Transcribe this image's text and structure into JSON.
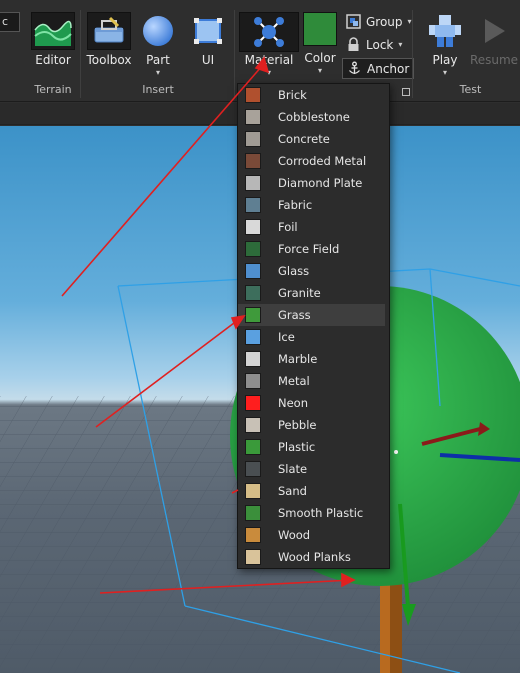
{
  "ribbon": {
    "left_dropdown_char": "c",
    "terrain": {
      "editor_label": "Editor",
      "group_label": "Terrain"
    },
    "insert": {
      "toolbox_label": "Toolbox",
      "part_label": "Part",
      "ui_label": "UI",
      "group_label": "Insert"
    },
    "material_label": "Material",
    "color_label": "Color",
    "color_value": "#2f8b3a",
    "group_label_btn": "Group",
    "lock_label": "Lock",
    "anchor_label": "Anchor",
    "test": {
      "play_label": "Play",
      "resume_label": "Resume",
      "group_label": "Test"
    }
  },
  "material_menu": {
    "selected_index": 10,
    "items": [
      {
        "label": "Brick",
        "swatch": "#b0502e",
        "icon": "brick-icon"
      },
      {
        "label": "Cobblestone",
        "swatch": "#a8a29a",
        "icon": "cobblestone-icon"
      },
      {
        "label": "Concrete",
        "swatch": "#a09b94",
        "icon": "concrete-icon"
      },
      {
        "label": "Corroded Metal",
        "swatch": "#7a4a38",
        "icon": "corroded-metal-icon"
      },
      {
        "label": "Diamond Plate",
        "swatch": "#b7b7b7",
        "icon": "diamond-plate-icon"
      },
      {
        "label": "Fabric",
        "swatch": "#5f7f92",
        "icon": "fabric-icon"
      },
      {
        "label": "Foil",
        "swatch": "#d9d9d9",
        "icon": "foil-icon"
      },
      {
        "label": "Force Field",
        "swatch": "#2d6b3a",
        "icon": "force-field-icon"
      },
      {
        "label": "Glass",
        "swatch": "#4f8fcf",
        "icon": "glass-icon"
      },
      {
        "label": "Granite",
        "swatch": "#3d6e5c",
        "icon": "granite-icon"
      },
      {
        "label": "Grass",
        "swatch": "#3f9a3b",
        "icon": "grass-icon"
      },
      {
        "label": "Ice",
        "swatch": "#5aa0e0",
        "icon": "ice-icon"
      },
      {
        "label": "Marble",
        "swatch": "#d4d4d4",
        "icon": "marble-icon"
      },
      {
        "label": "Metal",
        "swatch": "#8e8e8e",
        "icon": "metal-icon"
      },
      {
        "label": "Neon",
        "swatch": "#ff1e1e",
        "icon": "neon-icon"
      },
      {
        "label": "Pebble",
        "swatch": "#c8c1b6",
        "icon": "pebble-icon"
      },
      {
        "label": "Plastic",
        "swatch": "#3a9a3a",
        "icon": "plastic-icon"
      },
      {
        "label": "Slate",
        "swatch": "#4a4f52",
        "icon": "slate-icon"
      },
      {
        "label": "Sand",
        "swatch": "#d6bd87",
        "icon": "sand-icon"
      },
      {
        "label": "Smooth Plastic",
        "swatch": "#3b8f3b",
        "icon": "smooth-plastic-icon"
      },
      {
        "label": "Wood",
        "swatch": "#c98b3c",
        "icon": "wood-icon"
      },
      {
        "label": "Wood Planks",
        "swatch": "#d9c39a",
        "icon": "wood-planks-icon"
      }
    ]
  }
}
